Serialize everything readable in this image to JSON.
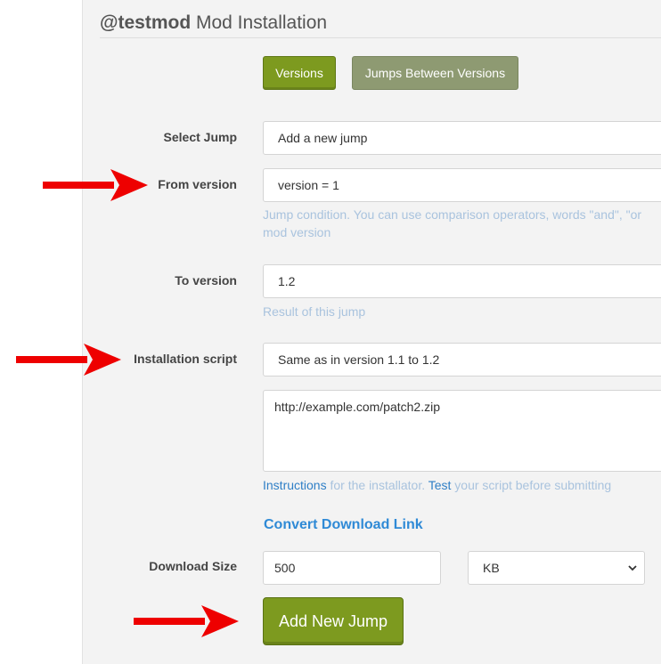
{
  "header": {
    "mod_name": "@testmod",
    "title_suffix": "Mod Installation"
  },
  "tabs": [
    {
      "label": "Versions"
    },
    {
      "label": "Jumps Between Versions"
    }
  ],
  "form": {
    "select_jump": {
      "label": "Select Jump",
      "value": "Add a new jump"
    },
    "from_version": {
      "label": "From version",
      "value": "version = 1",
      "help_line1": "Jump condition. You can use comparison operators, words \"and\", \"or",
      "help_line2": "mod version"
    },
    "to_version": {
      "label": "To version",
      "value": "1.2",
      "help": "Result of this jump"
    },
    "installation_script": {
      "label": "Installation script",
      "select_value": "Same as in version 1.1 to 1.2",
      "script": "http://example.com/patch2.zip",
      "help_link1": "Instructions",
      "help_text1": " for the installator. ",
      "help_link2": "Test",
      "help_text2": " your script before submitting"
    },
    "convert_link": "Convert Download Link",
    "download_size": {
      "label": "Download Size",
      "value": "500",
      "unit": "KB"
    },
    "submit_label": "Add New Jump"
  },
  "colors": {
    "accent_green": "#7d9a1f",
    "inactive_tab": "#8e9a72",
    "link_blue": "#2f8ad6",
    "annotation_arrow": "#ee0000"
  }
}
